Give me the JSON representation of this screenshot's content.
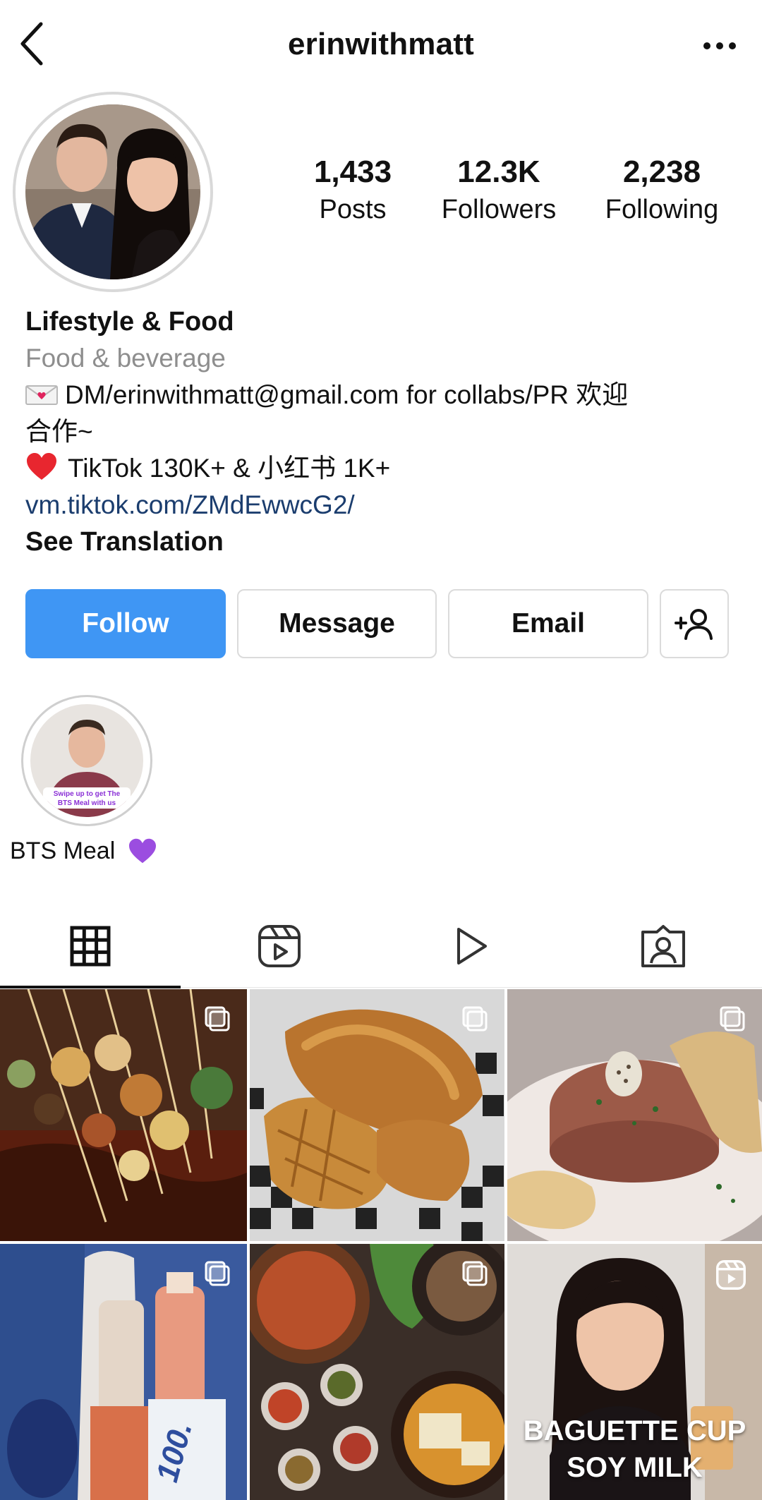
{
  "header": {
    "username": "erinwithmatt"
  },
  "profile": {
    "stats": [
      {
        "count": "1,433",
        "label": "Posts"
      },
      {
        "count": "12.3K",
        "label": "Followers"
      },
      {
        "count": "2,238",
        "label": "Following"
      }
    ],
    "name": "Lifestyle & Food",
    "category": "Food & beverage",
    "bio_line1": "DM/erinwithmatt@gmail.com for collabs/PR 欢迎",
    "bio_line2": "合作~",
    "bio_line3": "TikTok 130K+ & 小红书 1K+",
    "link": "vm.tiktok.com/ZMdEwwcG2/",
    "see_translation": "See Translation"
  },
  "actions": {
    "follow": "Follow",
    "message": "Message",
    "email": "Email"
  },
  "highlights": [
    {
      "label": "BTS Meal",
      "sticker_line1": "Swipe up to get The",
      "sticker_line2": "BTS Meal with us"
    }
  ],
  "tabs": [
    {
      "icon": "grid-icon",
      "active": true
    },
    {
      "icon": "reels-icon",
      "active": false
    },
    {
      "icon": "video-play-icon",
      "active": false
    },
    {
      "icon": "tagged-icon",
      "active": false
    }
  ],
  "posts": [
    {
      "type": "album",
      "caption": ""
    },
    {
      "type": "album",
      "caption": ""
    },
    {
      "type": "album",
      "caption": ""
    },
    {
      "type": "album",
      "caption": ""
    },
    {
      "type": "album",
      "caption": ""
    },
    {
      "type": "reel",
      "caption_line1": "BAGUETTE CUP",
      "caption_line2": "SOY MILK"
    }
  ],
  "colors": {
    "follow_blue": "#3f96f4",
    "link_blue": "#1b3d6e",
    "secondary_text": "#8e8e8e",
    "border": "#dbdbdb"
  }
}
